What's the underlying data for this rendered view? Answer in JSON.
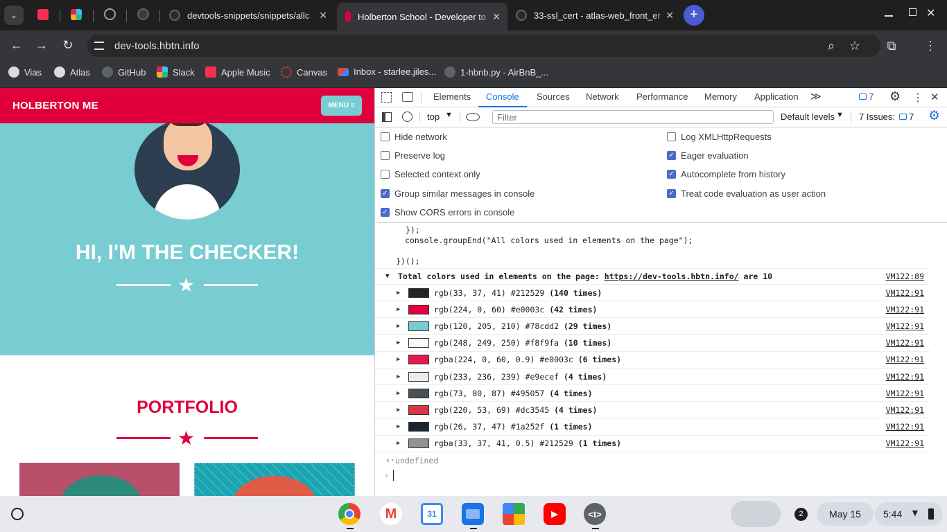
{
  "browser": {
    "tabs": [
      {
        "title": "devtools-snippets/snippets/allc",
        "close": "✕"
      },
      {
        "title": "Holberton School - Developer to",
        "close": "✕"
      },
      {
        "title": "33-ssl_cert - atlas-web_front_er",
        "close": "✕"
      }
    ],
    "new_tab": "+",
    "url": "dev-tools.hbtn.info",
    "bookmarks": [
      "Vias",
      "Atlas",
      "GitHub",
      "Slack",
      "Apple Music",
      "Canvas",
      "Inbox - starlee.jiles...",
      "1-hbnb.py - AirBnB_..."
    ]
  },
  "site": {
    "brand": "HOLBERTON ME",
    "menu": "MENU ≡",
    "hero_title": "HI, I'M THE CHECKER!",
    "section_title": "PORTFOLIO"
  },
  "devtools": {
    "tabs": [
      "Elements",
      "Console",
      "Sources",
      "Network",
      "Performance",
      "Memory",
      "Application"
    ],
    "more": "≫",
    "issues_badge": "7",
    "context": "top",
    "filter_placeholder": "Filter",
    "levels": "Default levels",
    "issues_label": "7 Issues:",
    "issues_count": "7",
    "settings": {
      "left": [
        {
          "label": "Hide network",
          "checked": false
        },
        {
          "label": "Preserve log",
          "checked": false
        },
        {
          "label": "Selected context only",
          "checked": false
        },
        {
          "label": "Group similar messages in console",
          "checked": true
        },
        {
          "label": "Show CORS errors in console",
          "checked": true
        }
      ],
      "right": [
        {
          "label": "Log XMLHttpRequests",
          "checked": false
        },
        {
          "label": "Eager evaluation",
          "checked": true
        },
        {
          "label": "Autocomplete from history",
          "checked": true
        },
        {
          "label": "Treat code evaluation as user action",
          "checked": true
        }
      ]
    },
    "console": {
      "code": [
        "});",
        "console.groupEnd(\"All colors used in elements on the page\");",
        "})();"
      ],
      "group_prefix": "Total colors used in elements on the page: ",
      "group_link": "https://dev-tools.hbtn.info/",
      "group_suffix": " are 10",
      "group_src": "VM122:89",
      "colors": [
        {
          "label": "rgb(33, 37, 41) #212529",
          "count": "(140 times)",
          "hex": "#212529",
          "src": "VM122:91"
        },
        {
          "label": "rgb(224, 0, 60) #e0003c",
          "count": "(42 times)",
          "hex": "#e0003c",
          "src": "VM122:91"
        },
        {
          "label": "rgb(120, 205, 210) #78cdd2",
          "count": "(29 times)",
          "hex": "#78cdd2",
          "src": "VM122:91"
        },
        {
          "label": "rgb(248, 249, 250) #f8f9fa",
          "count": "(10 times)",
          "hex": "#f8f9fa",
          "src": "VM122:91"
        },
        {
          "label": "rgba(224, 0, 60, 0.9) #e0003c",
          "count": "(6 times)",
          "hex": "#e41a50",
          "src": "VM122:91"
        },
        {
          "label": "rgb(233, 236, 239) #e9ecef",
          "count": "(4 times)",
          "hex": "#e9ecef",
          "src": "VM122:91"
        },
        {
          "label": "rgb(73, 80, 87) #495057",
          "count": "(4 times)",
          "hex": "#495057",
          "src": "VM122:91"
        },
        {
          "label": "rgb(220, 53, 69) #dc3545",
          "count": "(4 times)",
          "hex": "#dc3545",
          "src": "VM122:91"
        },
        {
          "label": "rgb(26, 37, 47) #1a252f",
          "count": "(1 times)",
          "hex": "#1a252f",
          "src": "VM122:91"
        },
        {
          "label": "rgba(33, 37, 41, 0.5) #212529",
          "count": "(1 times)",
          "hex": "#909294",
          "src": "VM122:91"
        }
      ],
      "result": "undefined"
    }
  },
  "shelf": {
    "notifications": "2",
    "date": "May 15",
    "time": "5:44"
  }
}
